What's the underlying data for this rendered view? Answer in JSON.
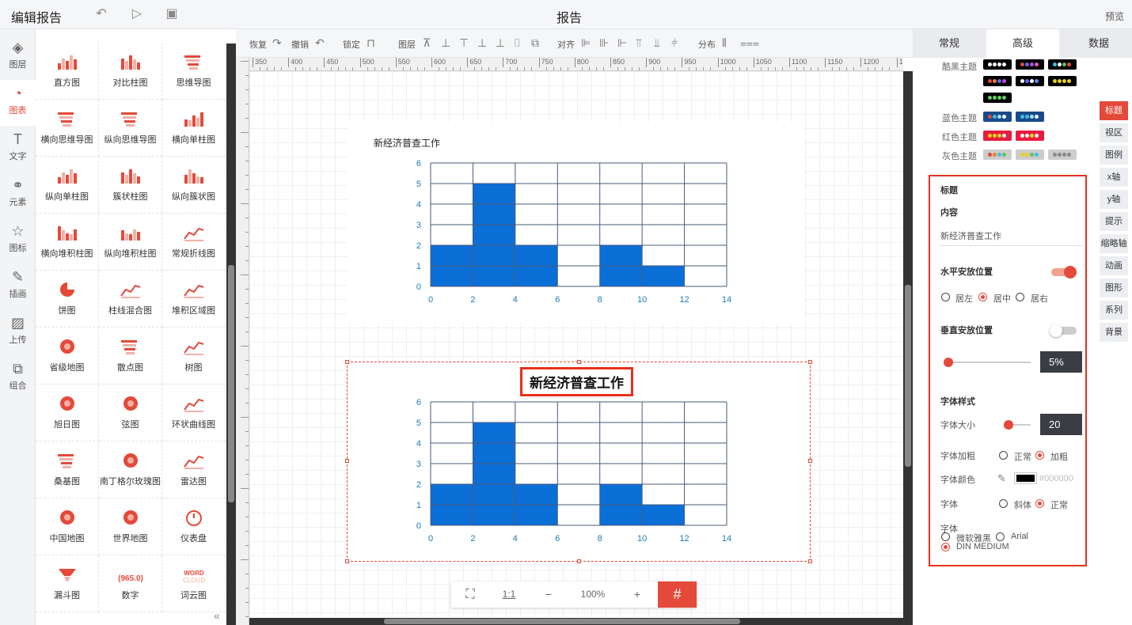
{
  "header": {
    "title": "编辑报告",
    "center_title": "报告",
    "preview": "预览"
  },
  "left_tabs": [
    {
      "label": "图层",
      "icon": "layers-icon"
    },
    {
      "label": "图表",
      "icon": "pie-chart-icon",
      "active": true
    },
    {
      "label": "文字",
      "icon": "text-icon"
    },
    {
      "label": "元素",
      "icon": "shapes-icon"
    },
    {
      "label": "图标",
      "icon": "star-icon"
    },
    {
      "label": "插画",
      "icon": "palette-icon"
    },
    {
      "label": "上传",
      "icon": "image-upload-icon"
    },
    {
      "label": "组合",
      "icon": "group-icon"
    }
  ],
  "palette": [
    "直方图",
    "对比柱图",
    "思维导图",
    "横向思维导图",
    "纵向思维导图",
    "横向单柱图",
    "纵向单柱图",
    "簇状柱图",
    "纵向簇状图",
    "横向堆积柱图",
    "纵向堆积柱图",
    "常规折线图",
    "饼图",
    "柱线混合图",
    "堆积区域图",
    "省级地图",
    "散点图",
    "树图",
    "旭日图",
    "弦图",
    "环状曲线图",
    "桑基图",
    "南丁格尔玫瑰图",
    "雷达图",
    "中国地图",
    "世界地图",
    "仪表盘",
    "漏斗图",
    "数字",
    "词云图"
  ],
  "palette_number_glyph": "965.0",
  "palette_wordcloud_glyph": [
    "WORD",
    "CLOUD"
  ],
  "toolbar": {
    "redo": "恢复",
    "undo": "撤销",
    "lock": "锁定",
    "layer": "图层",
    "align": "对齐",
    "distribute": "分布"
  },
  "ruler_labels": [
    "350",
    "400",
    "450",
    "500",
    "550",
    "600",
    "650",
    "700",
    "750",
    "800",
    "850",
    "900",
    "950",
    "1000",
    "1050",
    "1100",
    "1150",
    "1200",
    "1250"
  ],
  "chart_data": [
    {
      "type": "bar",
      "title": "新经济普查工作",
      "x_ticks": [
        0,
        2,
        4,
        6,
        8,
        10,
        12,
        14
      ],
      "y_ticks": [
        0,
        1,
        2,
        3,
        4,
        5,
        6
      ],
      "bins": [
        [
          0,
          2
        ],
        [
          2,
          4
        ],
        [
          4,
          6
        ],
        [
          6,
          8
        ],
        [
          8,
          10
        ],
        [
          10,
          12
        ],
        [
          12,
          14
        ]
      ],
      "values": [
        2,
        5,
        2,
        0,
        2,
        1,
        0
      ],
      "ylim": [
        0,
        6
      ],
      "xlim": [
        0,
        14
      ],
      "grid": true
    },
    {
      "type": "bar",
      "title": "新经济普查工作",
      "x_ticks": [
        0,
        2,
        4,
        6,
        8,
        10,
        12,
        14
      ],
      "y_ticks": [
        0,
        1,
        2,
        3,
        4,
        5,
        6
      ],
      "bins": [
        [
          0,
          2
        ],
        [
          2,
          4
        ],
        [
          4,
          6
        ],
        [
          6,
          8
        ],
        [
          8,
          10
        ],
        [
          10,
          12
        ],
        [
          12,
          14
        ]
      ],
      "values": [
        2,
        5,
        2,
        0,
        2,
        1,
        0
      ],
      "ylim": [
        0,
        6
      ],
      "xlim": [
        0,
        14
      ],
      "grid": true
    }
  ],
  "colors": {
    "accent": "#e4493a",
    "bar": "#0b6fd8",
    "axis_text": "#1a7bb8"
  },
  "zoom": {
    "fit": "⛶",
    "ratio": "1:1",
    "minus": "−",
    "value": "100%",
    "plus": "+",
    "grid": "#"
  },
  "right_tabs": [
    "常规",
    "高级",
    "数据"
  ],
  "themes": [
    {
      "label": "酷黑主题"
    },
    {
      "label": "蓝色主题"
    },
    {
      "label": "红色主题"
    },
    {
      "label": "灰色主题"
    }
  ],
  "side_tabs": [
    "标题",
    "视区",
    "图例",
    "x轴",
    "y轴",
    "提示",
    "缩略轴",
    "动画",
    "图形",
    "系列",
    "背景"
  ],
  "form": {
    "section": "标题",
    "content_label": "内容",
    "content_value": "新经济普查工作",
    "h_pos_label": "水平安放位置",
    "h_options": [
      "居左",
      "居中",
      "居右"
    ],
    "h_selected": "居中",
    "v_pos_label": "垂直安放位置",
    "v_value": "5%",
    "font_style": "字体样式",
    "font_size_label": "字体大小",
    "font_size": "20",
    "bold_label": "字体加粗",
    "bold_options": [
      "正常",
      "加粗"
    ],
    "bold_selected": "加粗",
    "color_label": "字体颜色",
    "color_value": "#000000",
    "italic_label": "字体",
    "italic_options": [
      "斜体",
      "正常"
    ],
    "italic_selected": "正常",
    "family_label": "字体",
    "family_options": [
      "微软雅黑",
      "Arial",
      "DIN MEDIUM"
    ],
    "family_selected": "DIN MEDIUM"
  }
}
